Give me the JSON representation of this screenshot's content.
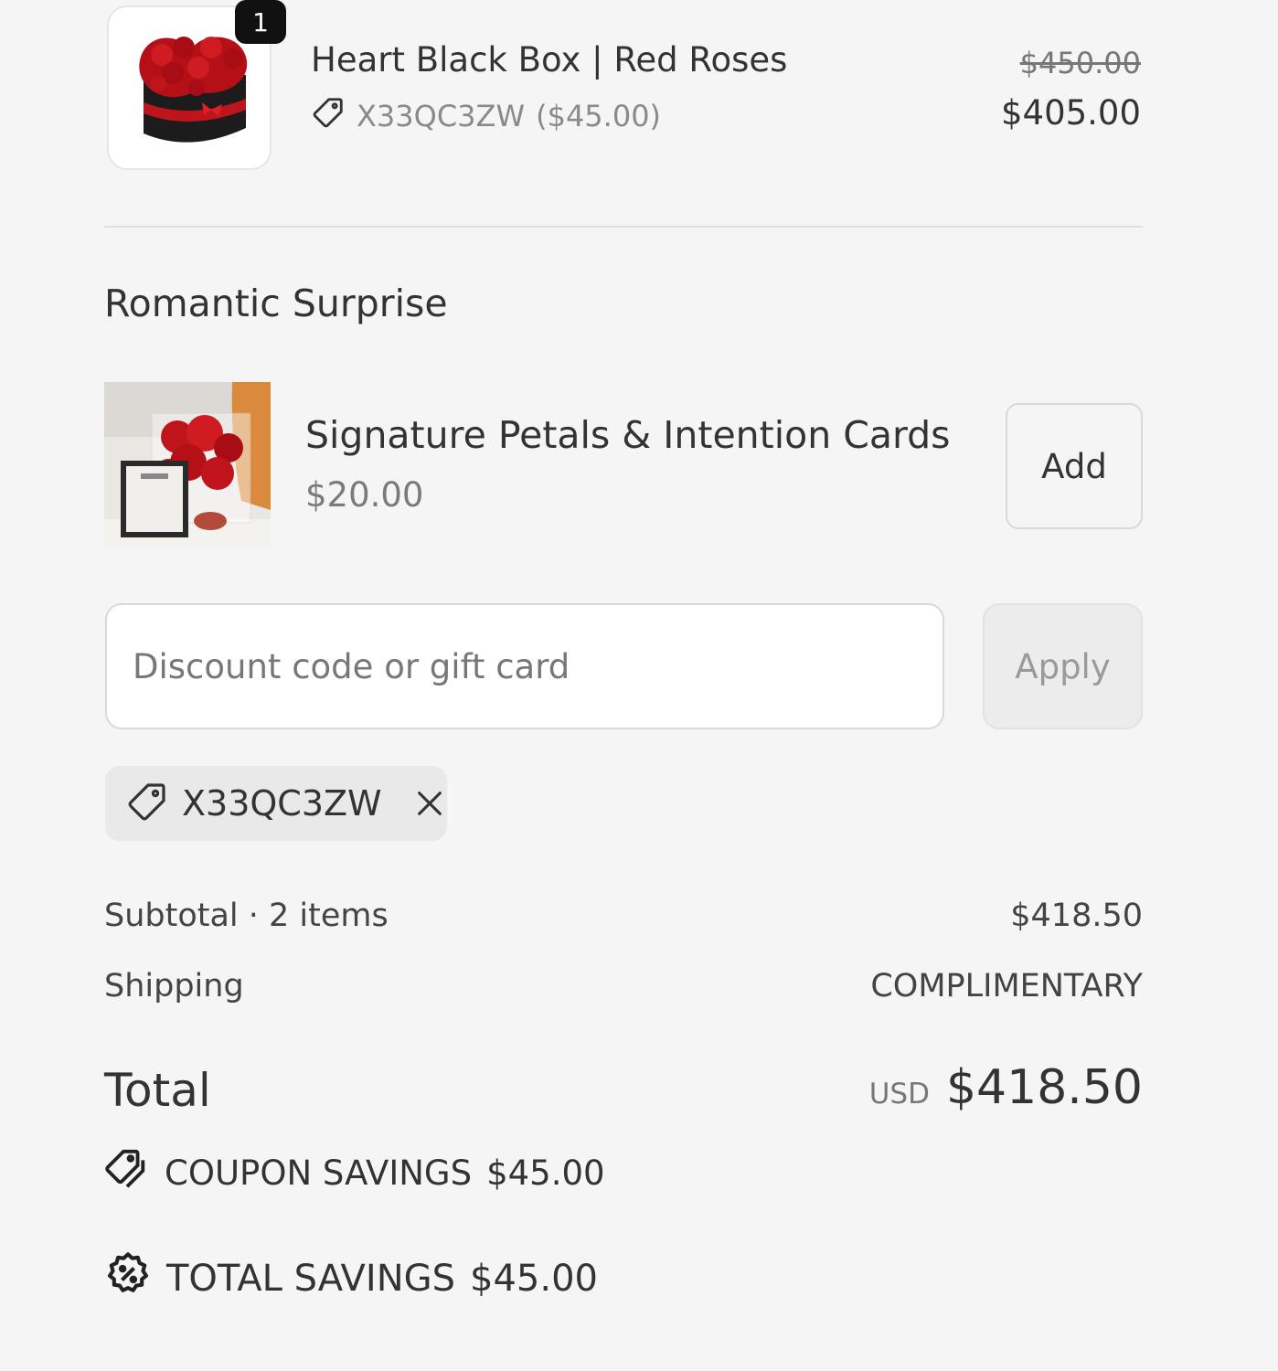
{
  "cart_item": {
    "quantity": "1",
    "title": "Heart Black Box | Red Roses",
    "discount_code": "X33QC3ZW",
    "discount_amount": "($45.00)",
    "original_price": "$450.00",
    "price": "$405.00",
    "image_icon": "rose-heart-box-icon"
  },
  "upsell": {
    "heading": "Romantic Surprise",
    "product_name": "Signature Petals & Intention Cards",
    "product_price": "$20.00",
    "add_label": "Add",
    "image_icon": "petals-box-icon"
  },
  "discount": {
    "placeholder": "Discount code or gift card",
    "value": "",
    "apply_label": "Apply",
    "applied_code": "X33QC3ZW"
  },
  "summary": {
    "subtotal_label": "Subtotal · 2 items",
    "subtotal_value": "$418.50",
    "shipping_label": "Shipping",
    "shipping_value": "COMPLIMENTARY",
    "total_label": "Total",
    "currency": "USD",
    "total_value": "$418.50",
    "coupon_savings_label": "COUPON SAVINGS",
    "coupon_savings_value": "$45.00",
    "total_savings_label": "TOTAL SAVINGS",
    "total_savings_value": "$45.00"
  },
  "colors": {
    "background": "#f5f5f5",
    "text": "#333333",
    "muted": "#8a8a8a",
    "badge": "#111111",
    "rose_red": "#c0141c"
  }
}
